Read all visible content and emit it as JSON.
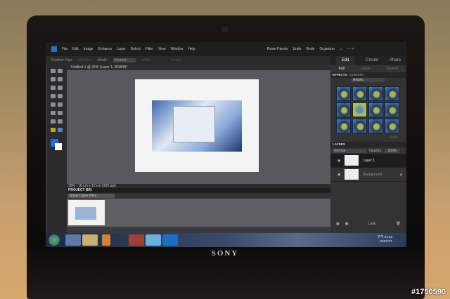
{
  "menu": [
    "File",
    "Edit",
    "Image",
    "Enhance",
    "Layer",
    "Select",
    "Filter",
    "View",
    "Window",
    "Help"
  ],
  "toolbar": {
    "reset": "Reset Panels",
    "undo": "Undo",
    "redo": "Redo",
    "organizer": "Organizer"
  },
  "options": {
    "feather": "Feather: 0 px",
    "antialias": "Anti-alias",
    "mode_label": "Mode:",
    "mode": "Normal",
    "width": "Width:",
    "height": "Height:"
  },
  "doc_tab": "Untitled-1 @ 25% (Layer 1, RGB/8)*",
  "status": {
    "zoom": "25%",
    "size": "16 cm x 12 cm (300 ppi)"
  },
  "bin": {
    "title": "PROJECT BIN",
    "dropdown": "Show Open Files"
  },
  "right": {
    "tabs": [
      "Edit",
      "Create",
      "Share"
    ],
    "modes": [
      "Full",
      "Quick",
      "Guided"
    ],
    "effects_tabs": [
      "EFFECTS",
      "CONTENT"
    ],
    "filter": "Artistic",
    "apply": "Apply",
    "layers_title": "LAYERS",
    "blend": "Normal",
    "opacity_label": "Opacity:",
    "opacity": "100%",
    "layers": [
      "Layer 1",
      "Background"
    ],
    "lock": "Lock:"
  },
  "tray": {
    "time": "下午 01:33",
    "date": "2012/7/1"
  },
  "brand": "SONY",
  "watermark": "#1750590"
}
